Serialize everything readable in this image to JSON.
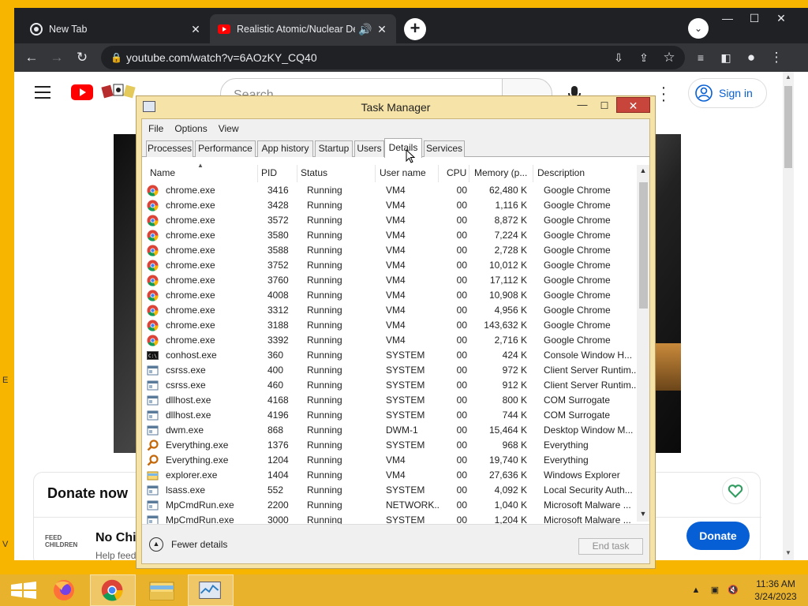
{
  "browser": {
    "tabs": [
      {
        "title": "New Tab",
        "active": false
      },
      {
        "title": "Realistic Atomic/Nuclear Des",
        "active": true
      }
    ],
    "new_tab": "+",
    "tab_search": "⌄",
    "window_controls": {
      "minimize": "—",
      "maximize": "☐",
      "close": "✕"
    },
    "url": "youtube.com/watch?v=6AOzKY_CQ40"
  },
  "youtube": {
    "search_placeholder": "Search",
    "sign_in": "Sign in",
    "donate_title": "Donate now",
    "fundraiser_title": "No Chil",
    "fundraiser_sub": "Help feed",
    "feed_logo": "FEED\nCHILDREN",
    "donate_button": "Donate"
  },
  "desktop": {
    "left_text_1": "E",
    "left_text_2": "V"
  },
  "task_manager": {
    "title": "Task Manager",
    "menu": [
      "File",
      "Options",
      "View"
    ],
    "tabs": [
      "Processes",
      "Performance",
      "App history",
      "Startup",
      "Users",
      "Details",
      "Services"
    ],
    "active_tab": "Details",
    "columns": {
      "name": "Name",
      "pid": "PID",
      "status": "Status",
      "user": "User name",
      "cpu": "CPU",
      "memory": "Memory (p...",
      "description": "Description"
    },
    "rows": [
      {
        "icon": "chrome",
        "name": "chrome.exe",
        "pid": "3416",
        "status": "Running",
        "user": "VM4",
        "cpu": "00",
        "memory": "62,480 K",
        "description": "Google Chrome"
      },
      {
        "icon": "chrome",
        "name": "chrome.exe",
        "pid": "3428",
        "status": "Running",
        "user": "VM4",
        "cpu": "00",
        "memory": "1,116 K",
        "description": "Google Chrome"
      },
      {
        "icon": "chrome",
        "name": "chrome.exe",
        "pid": "3572",
        "status": "Running",
        "user": "VM4",
        "cpu": "00",
        "memory": "8,872 K",
        "description": "Google Chrome"
      },
      {
        "icon": "chrome",
        "name": "chrome.exe",
        "pid": "3580",
        "status": "Running",
        "user": "VM4",
        "cpu": "00",
        "memory": "7,224 K",
        "description": "Google Chrome"
      },
      {
        "icon": "chrome",
        "name": "chrome.exe",
        "pid": "3588",
        "status": "Running",
        "user": "VM4",
        "cpu": "00",
        "memory": "2,728 K",
        "description": "Google Chrome"
      },
      {
        "icon": "chrome",
        "name": "chrome.exe",
        "pid": "3752",
        "status": "Running",
        "user": "VM4",
        "cpu": "00",
        "memory": "10,012 K",
        "description": "Google Chrome"
      },
      {
        "icon": "chrome",
        "name": "chrome.exe",
        "pid": "3760",
        "status": "Running",
        "user": "VM4",
        "cpu": "00",
        "memory": "17,112 K",
        "description": "Google Chrome"
      },
      {
        "icon": "chrome",
        "name": "chrome.exe",
        "pid": "4008",
        "status": "Running",
        "user": "VM4",
        "cpu": "00",
        "memory": "10,908 K",
        "description": "Google Chrome"
      },
      {
        "icon": "chrome",
        "name": "chrome.exe",
        "pid": "3312",
        "status": "Running",
        "user": "VM4",
        "cpu": "00",
        "memory": "4,956 K",
        "description": "Google Chrome"
      },
      {
        "icon": "chrome",
        "name": "chrome.exe",
        "pid": "3188",
        "status": "Running",
        "user": "VM4",
        "cpu": "00",
        "memory": "143,632 K",
        "description": "Google Chrome"
      },
      {
        "icon": "chrome",
        "name": "chrome.exe",
        "pid": "3392",
        "status": "Running",
        "user": "VM4",
        "cpu": "00",
        "memory": "2,716 K",
        "description": "Google Chrome"
      },
      {
        "icon": "console",
        "name": "conhost.exe",
        "pid": "360",
        "status": "Running",
        "user": "SYSTEM",
        "cpu": "00",
        "memory": "424 K",
        "description": "Console Window H..."
      },
      {
        "icon": "window",
        "name": "csrss.exe",
        "pid": "400",
        "status": "Running",
        "user": "SYSTEM",
        "cpu": "00",
        "memory": "972 K",
        "description": "Client Server Runtim..."
      },
      {
        "icon": "window",
        "name": "csrss.exe",
        "pid": "460",
        "status": "Running",
        "user": "SYSTEM",
        "cpu": "00",
        "memory": "912 K",
        "description": "Client Server Runtim..."
      },
      {
        "icon": "window",
        "name": "dllhost.exe",
        "pid": "4168",
        "status": "Running",
        "user": "SYSTEM",
        "cpu": "00",
        "memory": "800 K",
        "description": "COM Surrogate"
      },
      {
        "icon": "window",
        "name": "dllhost.exe",
        "pid": "4196",
        "status": "Running",
        "user": "SYSTEM",
        "cpu": "00",
        "memory": "744 K",
        "description": "COM Surrogate"
      },
      {
        "icon": "window",
        "name": "dwm.exe",
        "pid": "868",
        "status": "Running",
        "user": "DWM-1",
        "cpu": "00",
        "memory": "15,464 K",
        "description": "Desktop Window M..."
      },
      {
        "icon": "magnifier",
        "name": "Everything.exe",
        "pid": "1376",
        "status": "Running",
        "user": "SYSTEM",
        "cpu": "00",
        "memory": "968 K",
        "description": "Everything"
      },
      {
        "icon": "magnifier",
        "name": "Everything.exe",
        "pid": "1204",
        "status": "Running",
        "user": "VM4",
        "cpu": "00",
        "memory": "19,740 K",
        "description": "Everything"
      },
      {
        "icon": "folder",
        "name": "explorer.exe",
        "pid": "1404",
        "status": "Running",
        "user": "VM4",
        "cpu": "00",
        "memory": "27,636 K",
        "description": "Windows Explorer"
      },
      {
        "icon": "window",
        "name": "lsass.exe",
        "pid": "552",
        "status": "Running",
        "user": "SYSTEM",
        "cpu": "00",
        "memory": "4,092 K",
        "description": "Local Security Auth..."
      },
      {
        "icon": "window",
        "name": "MpCmdRun.exe",
        "pid": "2200",
        "status": "Running",
        "user": "NETWORK...",
        "cpu": "00",
        "memory": "1,040 K",
        "description": "Microsoft Malware ..."
      },
      {
        "icon": "window",
        "name": "MpCmdRun.exe",
        "pid": "3000",
        "status": "Running",
        "user": "SYSTEM",
        "cpu": "00",
        "memory": "1,204 K",
        "description": "Microsoft Malware ..."
      }
    ],
    "fewer_details": "Fewer details",
    "end_task": "End task"
  },
  "taskbar": {
    "clock_time": "11:36 AM",
    "clock_date": "3/24/2023"
  }
}
